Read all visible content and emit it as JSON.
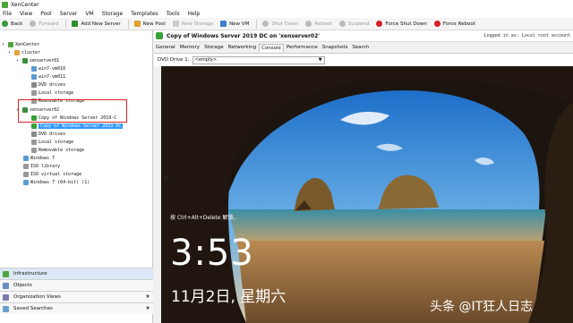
{
  "window": {
    "title": "XenCenter"
  },
  "menu": [
    "File",
    "View",
    "Pool",
    "Server",
    "VM",
    "Storage",
    "Templates",
    "Tools",
    "Help"
  ],
  "toolbar": {
    "back": "Back",
    "forward": "Forward",
    "add_new_server": "Add New Server",
    "new_pool": "New Pool",
    "new_storage": "New Storage",
    "new_vm": "New VM",
    "shut_down": "Shut Down",
    "reboot": "Reboot",
    "suspend": "Suspend",
    "force_shut_down": "Force Shut Down",
    "force_reboot": "Force Reboot"
  },
  "tree": {
    "root": "XenCenter",
    "cluster": "cluster",
    "server1": "xenserver01",
    "server1_items": [
      "win7-vm010",
      "win7-vm011",
      "DVD drives",
      "Local storage",
      "Removable storage"
    ],
    "server2": "xenserver02",
    "server2_vms": [
      "Copy of Windows Server 2019-C",
      "Copy of Windows Server 2019 DC"
    ],
    "server2_items": [
      "DVD drives",
      "Local storage",
      "Removable storage"
    ],
    "other": [
      "Windows 7",
      "ISO library",
      "ISO virtual storage",
      "Windows 7 (64-bit) (1)"
    ]
  },
  "nav": {
    "infrastructure": "Infrastructure",
    "objects": "Objects",
    "organization_views": "Organization Views",
    "saved_searches": "Saved Searches"
  },
  "vm_header": {
    "title": "Copy of Windows Server 2019 DC on 'xenserver02'",
    "login": "Logged in as: Local root account"
  },
  "tabs": [
    "General",
    "Memory",
    "Storage",
    "Networking",
    "Console",
    "Performance",
    "Snapshots",
    "Search"
  ],
  "active_tab": "Console",
  "dvd": {
    "label": "DVD Drive 1:",
    "value": "<empty>"
  },
  "lockscreen": {
    "ctrl_alt_del": "按 Ctrl+Alt+Delete 解锁。",
    "time": "3:53",
    "date": "11月2日, 星期六"
  },
  "watermark": "头条 @IT狂人日志",
  "colors": {
    "selection": "#3399ff",
    "highlight_box": "#dd2222",
    "vm_running": "#3aa03a"
  }
}
